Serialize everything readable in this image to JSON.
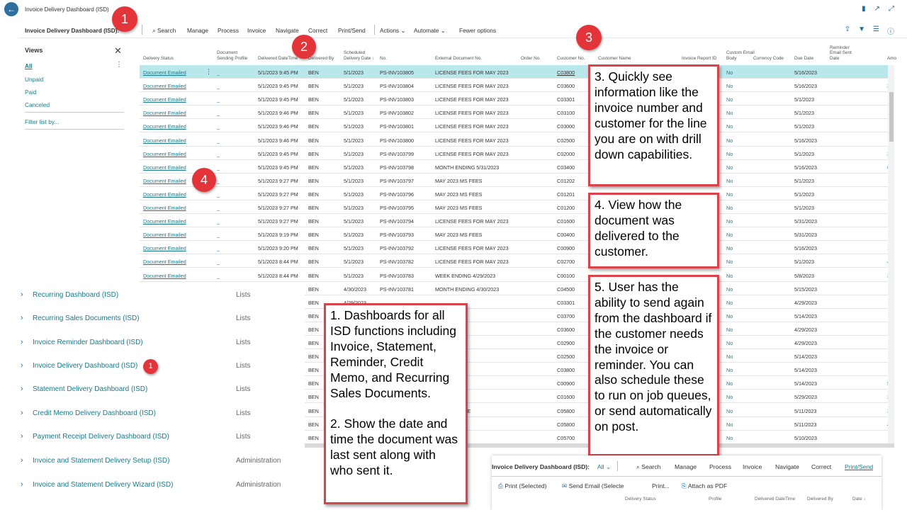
{
  "window": {
    "title": "Invoice Delivery Dashboard (ISD)"
  },
  "actionbar": {
    "page_name": "Invoice Delivery Dashboard (ISD):",
    "search": "Search",
    "manage": "Manage",
    "process": "Process",
    "invoice": "Invoice",
    "navigate": "Navigate",
    "correct": "Correct",
    "print_send": "Print/Send",
    "actions": "Actions",
    "automate": "Automate",
    "fewer_options": "Fewer options"
  },
  "views": {
    "title": "Views",
    "items": [
      "All",
      "Unpaid",
      "Paid",
      "Canceled"
    ],
    "filter_list": "Filter list by..."
  },
  "grid": {
    "columns": [
      "Delivery Status",
      "Document Sending Profile",
      "Delivered DateTime",
      "Delivered By",
      "Scheduled Delivery Date ↓",
      "No.",
      "External Document No.",
      "Order No.",
      "Customer No.",
      "Customer Name",
      "Invoice Report ID",
      "Custom Email Body",
      "Currency Code",
      "Due Date",
      "Reminder Email Sent Date",
      "Amo"
    ],
    "rows": [
      {
        "status": "Document Emailed",
        "profile": "_",
        "datetime": "5/1/2023 9:45 PM",
        "by": "BEN",
        "sched": "5/1/2023",
        "no": "PS-INV103805",
        "ext": "LICENSE FEES FOR MAY 2023",
        "cust": "C03800",
        "email": "No",
        "due": "5/16/2023",
        "amt": ""
      },
      {
        "status": "Document Emailed",
        "profile": "_",
        "datetime": "5/1/2023 9:45 PM",
        "by": "BEN",
        "sched": "5/1/2023",
        "no": "PS-INV103804",
        "ext": "LICENSE FEES FOR MAY 2023",
        "cust": "C03600",
        "email": "No",
        "due": "5/16/2023",
        "amt": "3"
      },
      {
        "status": "Document Emailed",
        "profile": "_",
        "datetime": "5/1/2023 9:45 PM",
        "by": "BEN",
        "sched": "5/1/2023",
        "no": "PS-INV103803",
        "ext": "LICENSE FEES FOR MAY 2023",
        "cust": "C03301",
        "email": "No",
        "due": "5/1/2023",
        "amt": ""
      },
      {
        "status": "Document Emailed",
        "profile": "_",
        "datetime": "5/1/2023 9:46 PM",
        "by": "BEN",
        "sched": "5/1/2023",
        "no": "PS-INV103802",
        "ext": "LICENSE FEES FOR MAY 2023",
        "cust": "C03100",
        "email": "No",
        "due": "5/1/2023",
        "amt": ""
      },
      {
        "status": "Document Emailed",
        "profile": "_",
        "datetime": "5/1/2023 9:46 PM",
        "by": "BEN",
        "sched": "5/1/2023",
        "no": "PS-INV103801",
        "ext": "LICENSE FEES FOR MAY 2023",
        "cust": "C03000",
        "email": "No",
        "due": "5/1/2023",
        "amt": ""
      },
      {
        "status": "Document Emailed",
        "profile": "_",
        "datetime": "5/1/2023 9:46 PM",
        "by": "BEN",
        "sched": "5/1/2023",
        "no": "PS-INV103800",
        "ext": "LICENSE FEES FOR MAY 2023",
        "cust": "C02500",
        "email": "No",
        "due": "5/16/2023",
        "amt": ""
      },
      {
        "status": "Document Emailed",
        "profile": "_",
        "datetime": "5/1/2023 9:45 PM",
        "by": "BEN",
        "sched": "5/1/2023",
        "no": "PS-INV103799",
        "ext": "LICENSE FEES FOR MAY 2023",
        "cust": "C02000",
        "email": "No",
        "due": "5/1/2023",
        "amt": "3"
      },
      {
        "status": "Document Emailed",
        "profile": "_",
        "datetime": "5/1/2023 9:45 PM",
        "by": "BEN",
        "sched": "5/1/2023",
        "no": "PS-INV103798",
        "ext": "MONTH ENDING 5/31/2023",
        "cust": "C03400",
        "email": "No",
        "due": "5/16/2023",
        "amt": "6"
      },
      {
        "status": "Document Emailed",
        "profile": "_",
        "datetime": "5/1/2023 9:27 PM",
        "by": "BEN",
        "sched": "5/1/2023",
        "no": "PS-INV103797",
        "ext": "MAY 2023 MS FEES",
        "cust": "C01202",
        "email": "No",
        "due": "5/1/2023",
        "amt": ""
      },
      {
        "status": "Document Emailed",
        "profile": "_",
        "datetime": "5/1/2023 9:27 PM",
        "by": "BEN",
        "sched": "5/1/2023",
        "no": "PS-INV103796",
        "ext": "MAY 2023 MS FEES",
        "cust": "C01201",
        "email": "No",
        "due": "5/1/2023",
        "amt": ""
      },
      {
        "status": "Document Emailed",
        "profile": "_",
        "datetime": "5/1/2023 9:27 PM",
        "by": "BEN",
        "sched": "5/1/2023",
        "no": "PS-INV103795",
        "ext": "MAY 2023 MS FEES",
        "cust": "C01200",
        "email": "No",
        "due": "5/1/2023",
        "amt": ""
      },
      {
        "status": "Document Emailed",
        "profile": "_",
        "datetime": "5/1/2023 9:27 PM",
        "by": "BEN",
        "sched": "5/1/2023",
        "no": "PS-INV103794",
        "ext": "LICENSE FEES FOR MAY 2023",
        "cust": "C01600",
        "email": "No",
        "due": "5/31/2023",
        "amt": ""
      },
      {
        "status": "Document Emailed",
        "profile": "_",
        "datetime": "5/1/2023 9:19 PM",
        "by": "BEN",
        "sched": "5/1/2023",
        "no": "PS-INV103793",
        "ext": "MAY 2023 MS FEES",
        "cust": "C00400",
        "email": "No",
        "due": "5/31/2023",
        "amt": ""
      },
      {
        "status": "Document Emailed",
        "profile": "_",
        "datetime": "5/1/2023 9:20 PM",
        "by": "BEN",
        "sched": "5/1/2023",
        "no": "PS-INV103792",
        "ext": "LICENSE FEES FOR MAY 2023",
        "cust": "C00900",
        "email": "No",
        "due": "5/16/2023",
        "amt": "1"
      },
      {
        "status": "Document Emailed",
        "profile": "_",
        "datetime": "5/1/2023 8:44 PM",
        "by": "BEN",
        "sched": "5/1/2023",
        "no": "PS-INV103782",
        "ext": "LICENSE FEES FOR MAY 2023",
        "cust": "C02700",
        "email": "No",
        "due": "5/1/2023",
        "amt": "4"
      },
      {
        "status": "Document Emailed",
        "profile": "_",
        "datetime": "5/1/2023 8:44 PM",
        "by": "BEN",
        "sched": "5/1/2023",
        "no": "PS-INV103783",
        "ext": "WEEK ENDING 4/29/2023",
        "cust": "C00100",
        "email": "No",
        "due": "5/8/2023",
        "amt": "3"
      },
      {
        "status": "",
        "profile": "",
        "datetime": "",
        "by": "BEN",
        "sched": "4/30/2023",
        "no": "PS-INV103781",
        "ext": "MONTH ENDING 4/30/2023",
        "cust": "C04500",
        "email": "No",
        "due": "5/15/2023",
        "amt": ""
      },
      {
        "status": "",
        "profile": "",
        "datetime": "",
        "by": "BEN",
        "sched": "4/29/2023",
        "no": "",
        "ext": "",
        "cust": "C03301",
        "email": "No",
        "due": "4/29/2023",
        "amt": ""
      },
      {
        "status": "",
        "profile": "",
        "datetime": "",
        "by": "BEN",
        "sched": "",
        "no": "",
        "ext": "G 4/29/2023",
        "cust": "C03700",
        "email": "No",
        "due": "5/14/2023",
        "amt": ""
      },
      {
        "status": "",
        "profile": "",
        "datetime": "",
        "by": "BEN",
        "sched": "",
        "no": "",
        "ext": "G 4/29/2023",
        "cust": "C03600",
        "email": "No",
        "due": "4/29/2023",
        "amt": ""
      },
      {
        "status": "",
        "profile": "",
        "datetime": "",
        "by": "BEN",
        "sched": "",
        "no": "",
        "ext": "G 4/29/2023",
        "cust": "C02900",
        "email": "No",
        "due": "4/29/2023",
        "amt": ""
      },
      {
        "status": "",
        "profile": "",
        "datetime": "",
        "by": "BEN",
        "sched": "",
        "no": "",
        "ext": "G 4/29/2023",
        "cust": "C02500",
        "email": "No",
        "due": "5/14/2023",
        "amt": ""
      },
      {
        "status": "",
        "profile": "",
        "datetime": "",
        "by": "BEN",
        "sched": "",
        "no": "",
        "ext": "G 4/29/2023",
        "cust": "C03800",
        "email": "No",
        "due": "5/14/2023",
        "amt": ""
      },
      {
        "status": "",
        "profile": "",
        "datetime": "",
        "by": "BEN",
        "sched": "",
        "no": "",
        "ext": "G 4/29/2023",
        "cust": "C00900",
        "email": "No",
        "due": "5/14/2023",
        "amt": "5"
      },
      {
        "status": "",
        "profile": "",
        "datetime": "",
        "by": "BEN",
        "sched": "",
        "no": "",
        "ext": "G 4/29/2023",
        "cust": "C01600",
        "email": "No",
        "due": "5/29/2023",
        "amt": "3"
      },
      {
        "status": "",
        "profile": "",
        "datetime": "",
        "by": "BEN",
        "sched": "",
        "no": "",
        "ext": "SION DEV FEE",
        "cust": "C05800",
        "email": "No",
        "due": "5/11/2023",
        "amt": "3"
      },
      {
        "status": "",
        "profile": "",
        "datetime": "",
        "by": "BEN",
        "sched": "",
        "no": "",
        "ext": "CENSE",
        "cust": "C05800",
        "email": "No",
        "due": "5/11/2023",
        "amt": "4"
      },
      {
        "status": "",
        "profile": "",
        "datetime": "",
        "by": "BEN",
        "sched": "",
        "no": "",
        "ext": "CENSE",
        "cust": "C05700",
        "email": "No",
        "due": "5/10/2023",
        "amt": ""
      }
    ]
  },
  "lists": [
    {
      "name": "Recurring Dashboard (ISD)",
      "category": "Lists"
    },
    {
      "name": "Recurring Sales Documents (ISD)",
      "category": "Lists"
    },
    {
      "name": "Invoice Reminder Dashboard (ISD)",
      "category": "Lists"
    },
    {
      "name": "Invoice Delivery Dashboard (ISD)",
      "category": "Lists"
    },
    {
      "name": "Statement Delivery Dashboard (ISD)",
      "category": "Lists"
    },
    {
      "name": "Credit Memo Delivery Dashboard (ISD)",
      "category": "Lists"
    },
    {
      "name": "Payment Receipt Delivery Dashboard (ISD)",
      "category": "Lists"
    },
    {
      "name": "Invoice and Statement Delivery Setup (ISD)",
      "category": "Administration"
    },
    {
      "name": "Invoice and Statement Delivery Wizard (ISD)",
      "category": "Administration"
    }
  ],
  "callouts": {
    "c1": "1. Dashboards for all ISD functions including Invoice, Statement, Reminder, Credit Memo, and Recurring Sales Documents.",
    "c2": "2. Show the date and time the document was last sent along with who sent it.",
    "c3": "3. Quickly see information like the invoice number and customer for the line you are on with drill down capabilities.",
    "c4": "4. View how the document was delivered to the customer.",
    "c5": "5. User has the ability to send again from the dashboard if the customer needs the invoice or reminder. You can also schedule these to run on job queues, or send automatically on post."
  },
  "badges": [
    "1",
    "2",
    "3",
    "4",
    "5",
    "1"
  ],
  "inset": {
    "page_name": "Invoice Delivery Dashboard (ISD):",
    "view": "All",
    "search": "Search",
    "manage": "Manage",
    "process": "Process",
    "invoice": "Invoice",
    "navigate": "Navigate",
    "correct": "Correct",
    "print_send": "Print/Send",
    "print_selected": "Print (Selected)",
    "send_email": "Send Email (Selecte",
    "print": "Print...",
    "attach_pdf": "Attach as PDF",
    "col_status": "Delivery Status",
    "col_profile": "Profile",
    "col_datetime": "Delivered DateTime",
    "col_by": "Delivered By",
    "col_date": "Date ↓"
  },
  "colors": {
    "accent": "#1a7a8a",
    "selected_row": "#b9e8ec",
    "callout_border": "#d9444a",
    "badge": "#e3343a"
  }
}
